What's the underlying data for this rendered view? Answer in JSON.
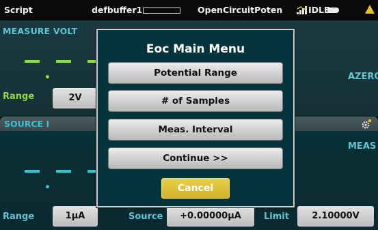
{
  "status_bar": {
    "script_label": "Script",
    "buffer_name": "defbuffer1",
    "script_name": "OpenCircuitPoten",
    "state": "IDLE"
  },
  "measure": {
    "title": "MEASURE VOLT",
    "range_label": "Range",
    "range_value": "2V",
    "autozero_label": "AZERO"
  },
  "source": {
    "title": "SOURCE I",
    "measure_label": "MEAS"
  },
  "bottom_row": {
    "range_label": "Range",
    "range_value": "1μA",
    "source_label": "Source",
    "source_value": "+0.00000μA",
    "limit_label": "Limit",
    "limit_value": "2.10000V"
  },
  "modal": {
    "title": "Eoc Main Menu",
    "buttons": [
      "Potential Range",
      "# of Samples",
      "Meas. Interval",
      "Continue >>"
    ],
    "cancel_label": "Cancel"
  },
  "colors": {
    "accent_cyan": "#5ec6d2",
    "measure_dash": "#8fdc3e",
    "source_dash": "#2fc8d2",
    "cancel_yellow": "#d8b82e",
    "warning_yellow": "#e8c21e"
  },
  "icons": [
    "signal-icon",
    "idle-arrow-icon",
    "warning-icon",
    "settings-icon"
  ]
}
